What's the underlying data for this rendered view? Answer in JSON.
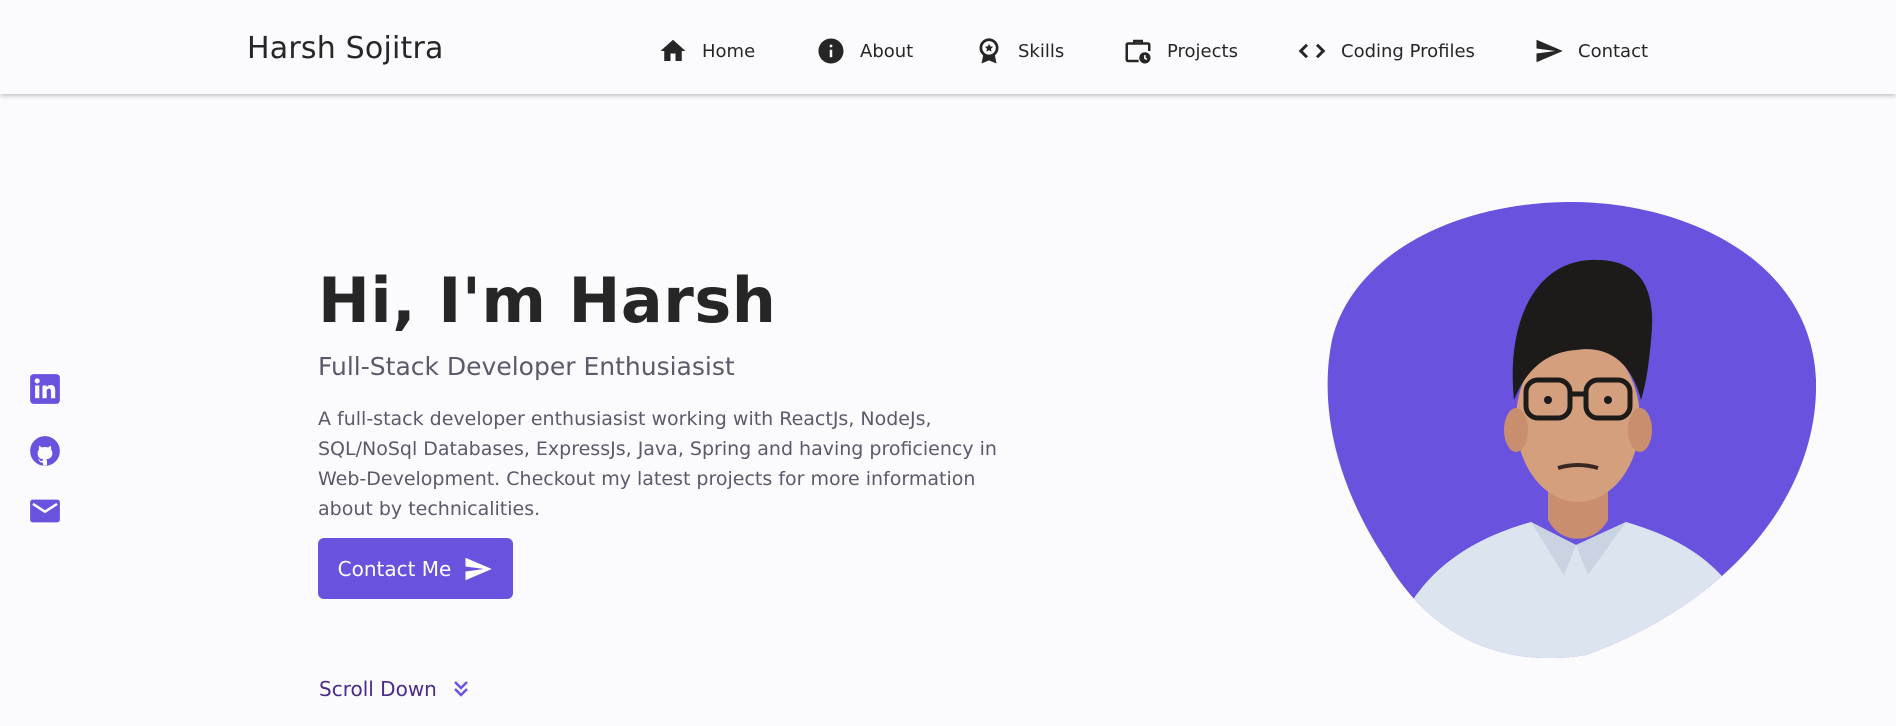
{
  "header": {
    "logo": "Harsh Sojitra",
    "nav": [
      {
        "label": "Home",
        "icon": "home-icon"
      },
      {
        "label": "About",
        "icon": "info-icon"
      },
      {
        "label": "Skills",
        "icon": "award-badge-icon"
      },
      {
        "label": "Projects",
        "icon": "briefcase-clock-icon"
      },
      {
        "label": "Coding Profiles",
        "icon": "code-brackets-icon"
      },
      {
        "label": "Contact",
        "icon": "send-icon"
      }
    ]
  },
  "social": [
    {
      "icon": "linkedin-icon"
    },
    {
      "icon": "github-icon"
    },
    {
      "icon": "mail-icon"
    }
  ],
  "hero": {
    "title": "Hi, I'm Harsh",
    "subtitle": "Full-Stack Developer Enthusiasist",
    "description": "A full-stack developer enthusiasist working with ReactJs, NodeJs, SQL/NoSql Databases, ExpressJs, Java, Spring and having proficiency in Web-Development. Checkout my latest projects for more information about by technicalities.",
    "cta_label": "Contact Me",
    "scroll_label": "Scroll Down"
  },
  "colors": {
    "accent": "#6952de",
    "background": "#fbfbfd",
    "text": "#262626",
    "muted": "#5a5a6a"
  }
}
